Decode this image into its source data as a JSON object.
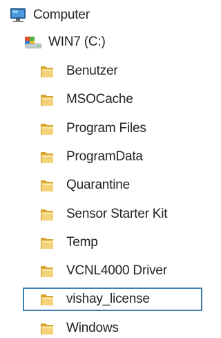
{
  "tree": {
    "root": {
      "label": "Computer",
      "icon": "computer-icon"
    },
    "drive": {
      "label": "WIN7 (C:)",
      "icon": "hard-drive-icon"
    },
    "folders": [
      {
        "label": "Benutzer",
        "icon": "folder-icon"
      },
      {
        "label": "MSOCache",
        "icon": "folder-icon"
      },
      {
        "label": "Program Files",
        "icon": "folder-icon"
      },
      {
        "label": "ProgramData",
        "icon": "folder-icon"
      },
      {
        "label": "Quarantine",
        "icon": "folder-icon"
      },
      {
        "label": "Sensor Starter Kit",
        "icon": "folder-icon"
      },
      {
        "label": "Temp",
        "icon": "folder-icon"
      },
      {
        "label": "VCNL4000 Driver",
        "icon": "folder-icon"
      },
      {
        "label": "vishay_license",
        "icon": "folder-icon",
        "selected": true
      },
      {
        "label": "Windows",
        "icon": "folder-icon"
      }
    ]
  },
  "colors": {
    "selection_border": "#3c7fb1",
    "folder_yellow": "#e8c25a",
    "text": "#222222"
  }
}
